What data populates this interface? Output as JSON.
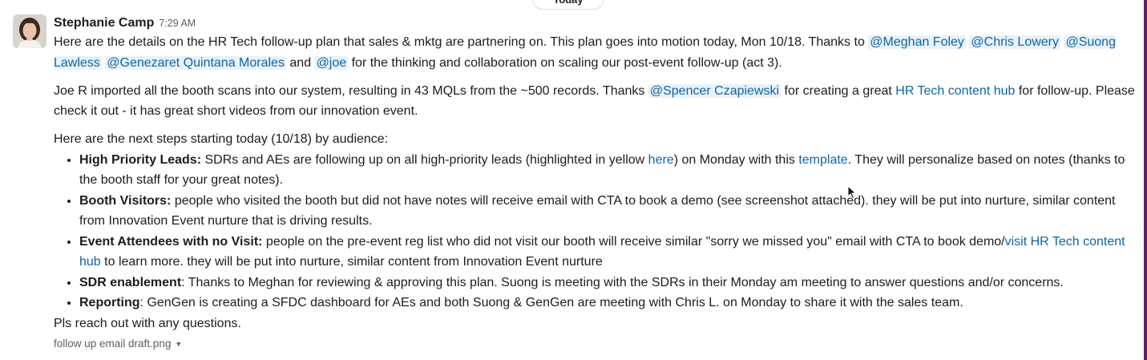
{
  "day_divider": "Today",
  "message": {
    "sender": "Stephanie Camp",
    "time": "7:29 AM",
    "p1": {
      "t1": "Here are the details on the HR Tech follow-up plan that sales & mktg are partnering on. This plan goes into motion today, Mon 10/18. Thanks to",
      "m1": "@Meghan Foley",
      "m2": "@Chris Lowery",
      "m3": "@Suong Lawless",
      "m4": "@Genezaret Quintana Morales",
      "t2": "and",
      "m5": "@joe",
      "t3": "for the thinking and collaboration on scaling our post-event follow-up (act 3)."
    },
    "p2": {
      "t1": "Joe R imported all the booth scans into our system, resulting in 43 MQLs from the ~500 records. Thanks",
      "m1": "@Spencer Czapiewski",
      "t2": "for creating a great",
      "link1": "HR Tech content hub",
      "t3": "for follow-up. Please check it out - it has great short videos from our innovation event."
    },
    "p3_intro": "Here are the next steps starting today (10/18) by audience:",
    "bullets": [
      {
        "bold": "High Priority Leads:",
        "t1": " SDRs and AEs are following up on all high-priority leads (highlighted in yellow ",
        "link1": "here",
        "t2": ") on Monday with this ",
        "link2": "template",
        "t3": ". They will personalize based on notes (thanks to the booth staff for your great notes)."
      },
      {
        "bold": "Booth Visitors:",
        "t1": " people who visited the booth but did not have notes will receive email with CTA to book a demo (see screenshot attached). they will be put into nurture, similar content from Innovation Event nurture that is driving results."
      },
      {
        "bold": "Event Attendees with no Visit:",
        "t1": " people on the pre-event reg list who did not visit our booth will receive similar \"sorry we missed you\" email with CTA to book demo/",
        "link1": "visit HR Tech content hub",
        "t2": " to learn more. they will be put into nurture, similar content from Innovation Event nurture"
      },
      {
        "bold": "SDR enablement",
        "t1": ": Thanks to Meghan for reviewing & approving this plan. Suong is meeting with the SDRs in their Monday am meeting to answer questions and/or concerns."
      },
      {
        "bold": "Reporting",
        "t1": ": GenGen is creating a SFDC dashboard for AEs and both Suong & GenGen are meeting with Chris L. on Monday to share it with the sales team."
      }
    ],
    "closing": "Pls reach out with any questions.",
    "attachment": {
      "filename": "follow up email draft.png",
      "caret_icon": "caret-down-icon"
    }
  },
  "colors": {
    "mention_bg": "#e8f2fa",
    "link": "#1264a3",
    "rail": "#611f69"
  }
}
